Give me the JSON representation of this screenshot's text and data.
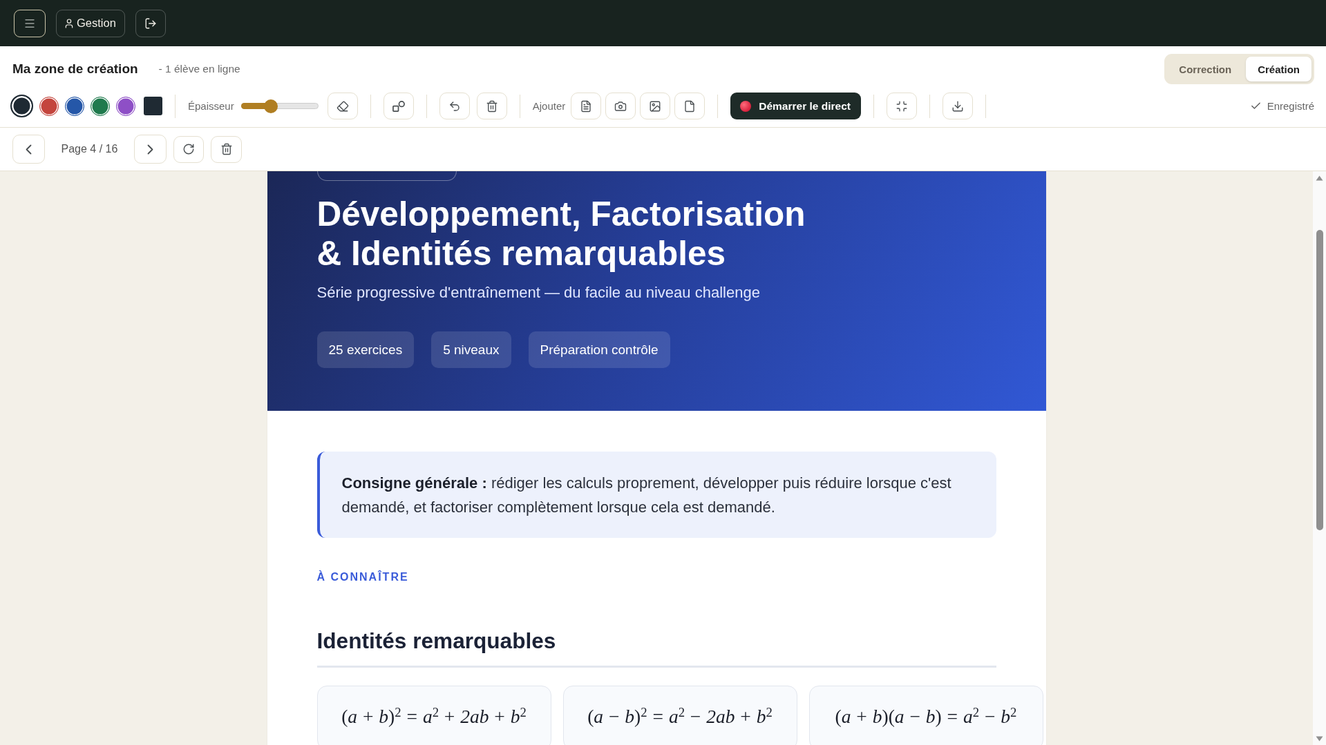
{
  "topbar": {
    "account_label": "Gestion"
  },
  "header": {
    "title": "Ma zone de création",
    "online_status": "- 1 élève en ligne",
    "modes": [
      {
        "label": "Correction",
        "selected": false
      },
      {
        "label": "Création",
        "selected": true
      }
    ]
  },
  "toolbar": {
    "colors": [
      {
        "kind": "circle",
        "color": "#1f2a33",
        "selected": true
      },
      {
        "kind": "circle",
        "color": "#c4453d",
        "selected": false
      },
      {
        "kind": "circle",
        "color": "#2557a8",
        "selected": false
      },
      {
        "kind": "circle",
        "color": "#1f7a4d",
        "selected": false
      },
      {
        "kind": "circle",
        "color": "#8e4fc6",
        "selected": false
      },
      {
        "kind": "square",
        "color": "#1f2a33",
        "selected": false
      }
    ],
    "thickness": {
      "label": "Épaisseur",
      "level": 0.39
    },
    "add_label": "Ajouter",
    "live_button": "Démarrer le direct",
    "save_status": "Enregistré"
  },
  "pager": {
    "label": "Page 4 / 16"
  },
  "document": {
    "title_lines": [
      "Développement, Factorisation",
      "& Identités remarquables"
    ],
    "subtitle": "Série progressive d'entraînement — du facile au niveau challenge",
    "tags": [
      "25 exercices",
      "5 niveaux",
      "Préparation contrôle"
    ],
    "instruction": "**Consigne générale :** rédiger les calculs proprement, développer puis réduire lorsque c'est demandé, et factoriser complètement lorsque cela est demandé.",
    "section_label": "À CONNAÎTRE",
    "section_title": "Identités remarquables",
    "formulas": [
      "(*a* + *b*)$^{2}$ = *a*$^{2}$ + *2ab* + *b*$^{2}$",
      "(*a* − *b*)$^{2}$ = *a*$^{2}$ − *2ab* + *b*$^{2}$",
      "(*a* + *b*)(*a* − *b*) = *a*$^{2}$ − *b*$^{2}$"
    ]
  }
}
